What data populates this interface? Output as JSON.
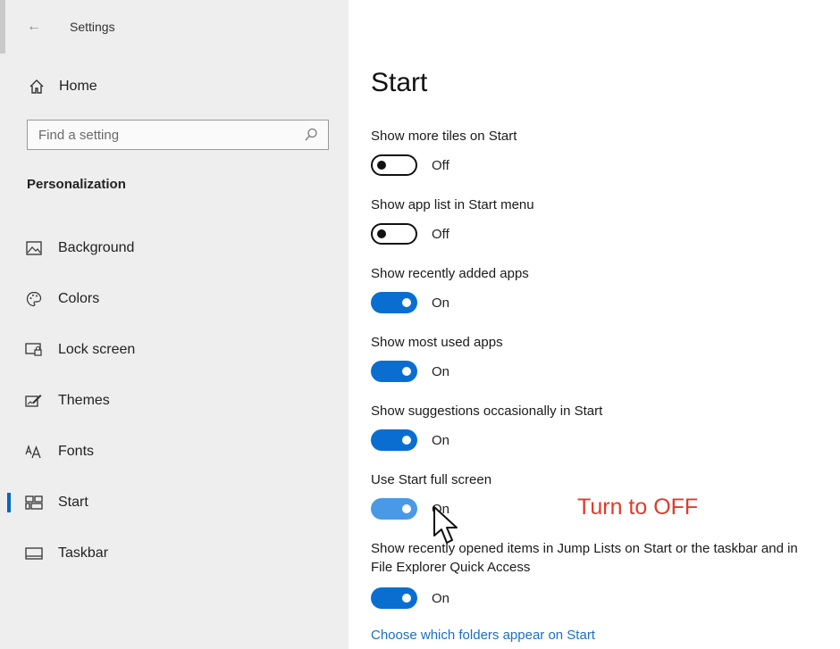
{
  "window": {
    "title": "Settings"
  },
  "sidebar": {
    "home_label": "Home",
    "search_placeholder": "Find a setting",
    "section_heading": "Personalization",
    "items": [
      {
        "label": "Background",
        "icon": "image-icon"
      },
      {
        "label": "Colors",
        "icon": "palette-icon"
      },
      {
        "label": "Lock screen",
        "icon": "lock-screen-icon"
      },
      {
        "label": "Themes",
        "icon": "themes-icon"
      },
      {
        "label": "Fonts",
        "icon": "fonts-icon"
      },
      {
        "label": "Start",
        "icon": "start-icon",
        "active": true
      },
      {
        "label": "Taskbar",
        "icon": "taskbar-icon"
      }
    ]
  },
  "main": {
    "title": "Start",
    "settings": [
      {
        "label": "Show more tiles on Start",
        "state": "Off",
        "on": false
      },
      {
        "label": "Show app list in Start menu",
        "state": "Off",
        "on": false
      },
      {
        "label": "Show recently added apps",
        "state": "On",
        "on": true
      },
      {
        "label": "Show most used apps",
        "state": "On",
        "on": true
      },
      {
        "label": "Show suggestions occasionally in Start",
        "state": "On",
        "on": true
      },
      {
        "label": "Use Start full screen",
        "state": "On",
        "on": true
      },
      {
        "label_line1": "Show recently opened items in Jump Lists on Start or the taskbar and in",
        "label_line2": "File Explorer Quick Access",
        "state": "On",
        "on": true
      }
    ],
    "link": "Choose which folders appear on Start",
    "annotation": "Turn to OFF"
  },
  "colors": {
    "accent": "#0a6ed1",
    "link": "#1b6fc2",
    "annotation": "#e23a2a"
  }
}
